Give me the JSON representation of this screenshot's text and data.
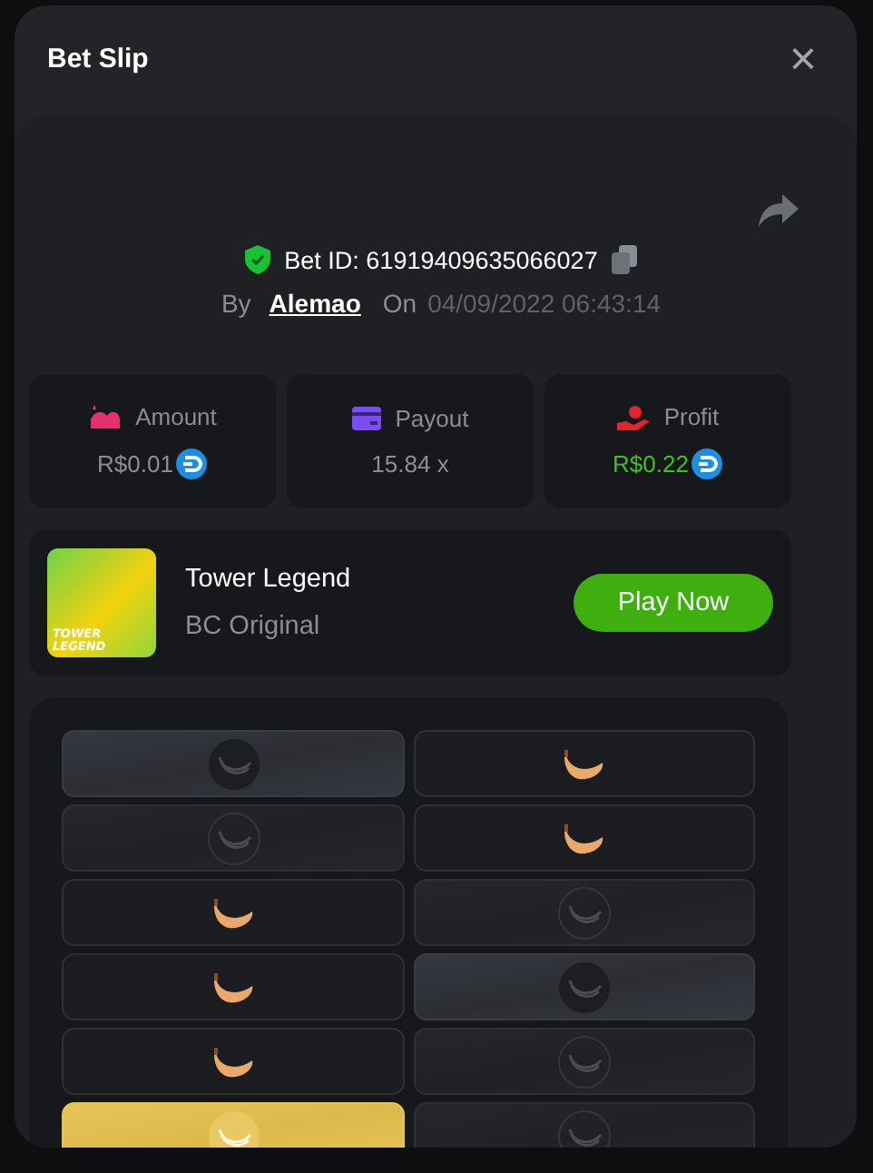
{
  "dialog": {
    "title": "Bet Slip",
    "close": "×"
  },
  "bet": {
    "id_label": "Bet ID: 61919409635066027",
    "by_label": "By",
    "user": "Alemao",
    "on_label": "On",
    "date": "04/09/2022 06:43:14"
  },
  "stats": [
    {
      "kind": "amount",
      "label": "Amount",
      "value": "R$0.01",
      "coin": true,
      "positive": false
    },
    {
      "kind": "payout",
      "label": "Payout",
      "value": "15.84 x",
      "coin": false,
      "positive": false
    },
    {
      "kind": "profit",
      "label": "Profit",
      "value": "R$0.22",
      "coin": true,
      "positive": true
    }
  ],
  "game": {
    "name": "Tower Legend",
    "provider": "BC Original",
    "thumb_caption": "TOWER LEGEND",
    "play_button": "Play Now"
  },
  "tiles": [
    {
      "kind": "picked"
    },
    {
      "kind": "banana"
    },
    {
      "kind": "hidden"
    },
    {
      "kind": "banana"
    },
    {
      "kind": "banana"
    },
    {
      "kind": "hidden"
    },
    {
      "kind": "banana"
    },
    {
      "kind": "picked"
    },
    {
      "kind": "banana"
    },
    {
      "kind": "hidden"
    },
    {
      "kind": "gold"
    },
    {
      "kind": "hidden"
    }
  ]
}
